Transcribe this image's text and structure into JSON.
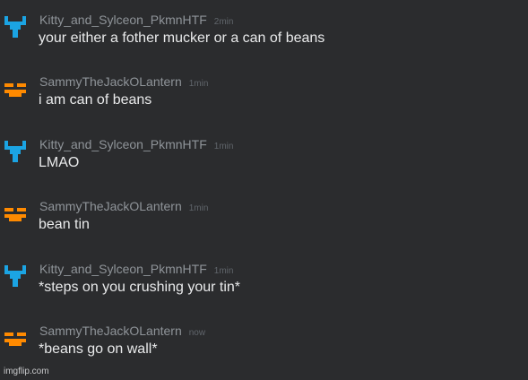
{
  "colors": {
    "background": "#2b2c2e",
    "username": "#8f9499",
    "time": "#60656b",
    "message_text": "#e9eaeb",
    "avatar_kitty": "#1ba4e3",
    "avatar_sammy": "#ff8a00"
  },
  "messages": [
    {
      "username": "Kitty_and_Sylceon_PkmnHTF",
      "time": "2min",
      "text": "your either a fother mucker or a can of beans",
      "avatar_icon": "blue-pixel-creature-icon"
    },
    {
      "username": "SammyTheJackOLantern",
      "time": "1min",
      "text": "i am can of beans",
      "avatar_icon": "orange-jack-o-lantern-face-icon"
    },
    {
      "username": "Kitty_and_Sylceon_PkmnHTF",
      "time": "1min",
      "text": "LMAO",
      "avatar_icon": "blue-pixel-creature-icon"
    },
    {
      "username": "SammyTheJackOLantern",
      "time": "1min",
      "text": "bean tin",
      "avatar_icon": "orange-jack-o-lantern-face-icon"
    },
    {
      "username": "Kitty_and_Sylceon_PkmnHTF",
      "time": "1min",
      "text": "*steps on you crushing your tin*",
      "avatar_icon": "blue-pixel-creature-icon"
    },
    {
      "username": "SammyTheJackOLantern",
      "time": "now",
      "text": "*beans go on wall*",
      "avatar_icon": "orange-jack-o-lantern-face-icon"
    }
  ],
  "watermark": "imgflip.com"
}
